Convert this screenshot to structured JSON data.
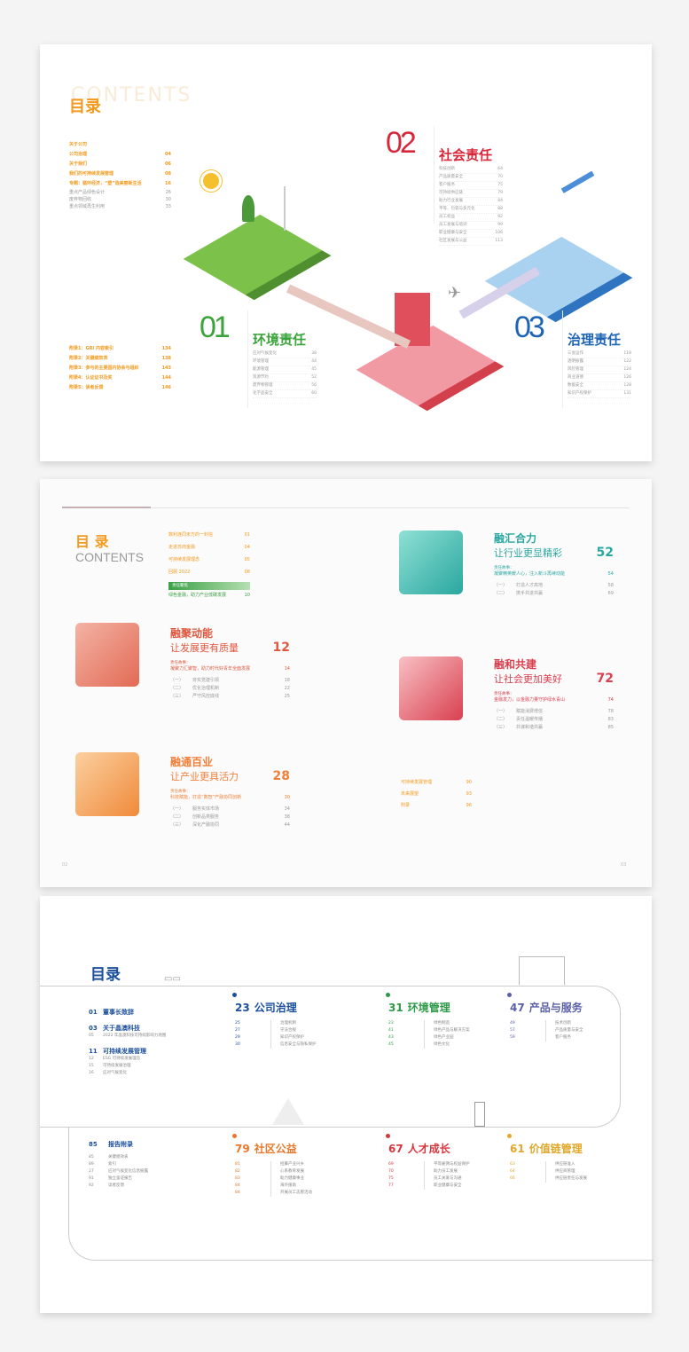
{
  "page1": {
    "title": "目录",
    "title_bg": "CONTENTS",
    "main_items": [
      [
        "关于公司",
        ""
      ],
      [
        "公司治理",
        "04"
      ],
      [
        "关于我们",
        "06"
      ],
      [
        "我们的可持续发展管理",
        "08"
      ],
      [
        "专题：循环经济，“塑”造美丽新生活",
        "16"
      ]
    ],
    "sub_items": [
      [
        "重点产品绿色设计",
        "26"
      ],
      [
        "废弃物回收",
        "30"
      ],
      [
        "重点领域再生利用",
        "33"
      ]
    ],
    "appendix": [
      [
        "附录1：GRI 内容索引",
        "134"
      ],
      [
        "附录2：关键绩效表",
        "138"
      ],
      [
        "附录3：参与的主要国内协会与组织",
        "143"
      ],
      [
        "附录4：认证证书及奖",
        "144"
      ],
      [
        "附录5：读者反馈",
        "146"
      ]
    ],
    "sections": [
      {
        "num": "01",
        "title": "环境责任",
        "color": "#3aa43a",
        "items": [
          [
            "应对气候变化",
            "38"
          ],
          [
            "环境管理",
            "44"
          ],
          [
            "能源管理",
            "45"
          ],
          [
            "资源节约",
            "52"
          ],
          [
            "废弃物管理",
            "56"
          ],
          [
            "化学品安全",
            "60"
          ]
        ]
      },
      {
        "num": "02",
        "title": "社会责任",
        "color": "#d9273a",
        "items": [
          [
            "科技创新",
            "64"
          ],
          [
            "产品质量安全",
            "70"
          ],
          [
            "客户服务",
            "75"
          ],
          [
            "可持续供应链",
            "79"
          ],
          [
            "助力行业发展",
            "84"
          ],
          [
            "平等、包容与多元化",
            "88"
          ],
          [
            "员工权益",
            "92"
          ],
          [
            "员工发展与培训",
            "99"
          ],
          [
            "职业健康与安全",
            "106"
          ],
          [
            "社区发展与公益",
            "113"
          ]
        ]
      },
      {
        "num": "03",
        "title": "治理责任",
        "color": "#1e64b4",
        "items": [
          [
            "三会运作",
            "118"
          ],
          [
            "透明披露",
            "122"
          ],
          [
            "风险管理",
            "124"
          ],
          [
            "商业道德",
            "126"
          ],
          [
            "数据安全",
            "128"
          ],
          [
            "知识产权保护",
            "131"
          ]
        ]
      }
    ]
  },
  "page2": {
    "title": "目 录",
    "subtitle": "CONTENTS",
    "intro": [
      [
        "数利连同未方的一封信",
        "01"
      ],
      [
        "走进苏商金融",
        "04"
      ],
      [
        "可持续发展理念",
        "05"
      ],
      [
        "回顾 2022",
        "08"
      ]
    ],
    "feature_tag": "责任聚焦",
    "feature": [
      "绿色金融，助力产业低碳发展",
      "10"
    ],
    "chapters": [
      {
        "t1": "融聚动能",
        "t2": "让发展更有质量",
        "page": "12",
        "color": "#e0583f",
        "focus_label": "责任故事：",
        "focus": [
          "凝聚力汇聚智，助力时代好青年全面发展",
          "14"
        ],
        "items": [
          [
            "（一）",
            "夯实党建引领",
            "18"
          ],
          [
            "（二）",
            "优化治理机制",
            "22"
          ],
          [
            "（三）",
            "严守风控底线",
            "25"
          ]
        ]
      },
      {
        "t1": "融通百业",
        "t2": "让产业更具活力",
        "page": "28",
        "color": "#f0803a",
        "focus_label": "责任故事：",
        "focus": [
          "科技赋能，打造“数智”产融协同创新",
          "30"
        ],
        "items": [
          [
            "（一）",
            "服务实体市场",
            "34"
          ],
          [
            "（二）",
            "创新品类服务",
            "38"
          ],
          [
            "（三）",
            "深化产融协同",
            "44"
          ]
        ]
      },
      {
        "t1": "融汇合力",
        "t2": "让行业更显精彩",
        "page": "52",
        "color": "#2aa7a0",
        "focus_label": "责任故事：",
        "focus": [
          "凝聚精英暖人心，注入新斗再续动能",
          "54"
        ],
        "items": [
          [
            "（一）",
            "打造人才高地",
            "58"
          ],
          [
            "（二）",
            "携手共进共赢",
            "69"
          ]
        ]
      },
      {
        "t1": "融和共建",
        "t2": "让社会更加美好",
        "page": "72",
        "color": "#d9404f",
        "focus_label": "责任故事：",
        "focus": [
          "金融发力，以金融力量守护绿水青山",
          "74"
        ],
        "items": [
          [
            "（一）",
            "赋能消费增信",
            "78"
          ],
          [
            "（二）",
            "责任温暖传播",
            "83"
          ],
          [
            "（三）",
            "共谋和谐共赢",
            "85"
          ]
        ]
      }
    ],
    "end": [
      [
        "可持续发展管理",
        "90"
      ],
      [
        "未来展望",
        "93"
      ],
      [
        "附录",
        "96"
      ]
    ],
    "folio_left": "02",
    "folio_right": "03"
  },
  "page3": {
    "title": "目录",
    "left": [
      {
        "num": "01",
        "title": "董事长致辞",
        "subs": []
      },
      {
        "num": "03",
        "title": "关于晶澳科技",
        "subs": [
          [
            "05",
            "2022 年晶澳科技可持续影响力地图"
          ]
        ]
      },
      {
        "num": "11",
        "title": "可持续发展管理",
        "subs": [
          [
            "12",
            "ESG 可持续发展理念"
          ],
          [
            "15",
            "可持续发展治理"
          ],
          [
            "16",
            "应对气候变化"
          ]
        ]
      }
    ],
    "top": [
      {
        "num": "23",
        "title": "公司治理",
        "color": "#1b4f9c",
        "items": [
          [
            "25",
            "治理机制"
          ],
          [
            "27",
            "守法合规"
          ],
          [
            "29",
            "知识产权保护"
          ],
          [
            "30",
            "信息安全与隐私保护"
          ]
        ]
      },
      {
        "num": "31",
        "title": "环境管理",
        "color": "#2e9a48",
        "items": [
          [
            "23",
            "绿色制造"
          ],
          [
            "41",
            "绿色产品与解决方案"
          ],
          [
            "43",
            "绿色产业园"
          ],
          [
            "45",
            "绿色文化"
          ]
        ]
      },
      {
        "num": "47",
        "title": "产品与服务",
        "color": "#5a5fa8",
        "items": [
          [
            "49",
            "技术创新"
          ],
          [
            "57",
            "产品质量与安全"
          ],
          [
            "59",
            "客户服务"
          ]
        ]
      }
    ],
    "appendix": {
      "num": "85",
      "title": "报告附录",
      "items": [
        [
          "85",
          "关键绩效表"
        ],
        [
          "89",
          "索引"
        ],
        [
          "27",
          "应对气候变化信息披露"
        ],
        [
          "91",
          "独立鉴证报告"
        ],
        [
          "92",
          "读者反馈"
        ]
      ]
    },
    "bottom": [
      {
        "num": "79",
        "title": "社区公益",
        "color": "#e8782c",
        "items": [
          [
            "81",
            "招募产业兴乡"
          ],
          [
            "82",
            "心系教育发展"
          ],
          [
            "83",
            "助力健康事业"
          ],
          [
            "84",
            "海外援助"
          ],
          [
            "84",
            "开展员工志愿活动"
          ]
        ]
      },
      {
        "num": "67",
        "title": "人才成长",
        "color": "#d8363e",
        "items": [
          [
            "69",
            "平等雇佣与权益保护"
          ],
          [
            "70",
            "助力员工发展"
          ],
          [
            "75",
            "员工关爱与沟通"
          ],
          [
            "77",
            "职业健康与安全"
          ]
        ]
      },
      {
        "num": "61",
        "title": "价值链管理",
        "color": "#e2a72b",
        "items": [
          [
            "63",
            "供应链准入"
          ],
          [
            "64",
            "供应商管理"
          ],
          [
            "66",
            "供应链责任与发展"
          ]
        ]
      }
    ]
  }
}
